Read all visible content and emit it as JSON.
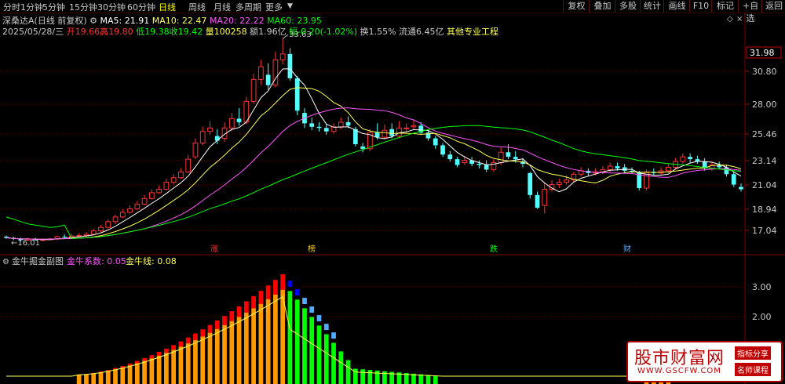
{
  "toolbar": {
    "timeframes": [
      "分时",
      "1分钟",
      "5分钟",
      "15分钟",
      "30分钟",
      "60分钟",
      "日线",
      "周线",
      "月线",
      "多周期",
      "更多"
    ],
    "active_timeframe": "日线",
    "buttons": [
      "复权",
      "叠加",
      "多股",
      "统计",
      "画线",
      "F10",
      "标记",
      "+自选",
      "返回"
    ]
  },
  "header": {
    "stock_name": "深桑达A",
    "mode": "(日线 前复权)",
    "ma5_label": "MA5: 21.91",
    "ma10_label": "MA10: 22.47",
    "ma20_label": "MA20: 22.22",
    "ma60_label": "MA60: 23.95"
  },
  "quote": {
    "date": "2025/05/28/三",
    "open": "开19.66",
    "high": "高19.80",
    "low": "低19.38",
    "close": "收19.42",
    "volume": "量100258",
    "amount": "额1.96亿",
    "change": "幅-0.20(-1.02%)",
    "turnover": "换1.55%",
    "float_value": "流通6.45亿",
    "industry": "其他专业工程"
  },
  "price_axis": [
    "30.80",
    "28.00",
    "25.46",
    "23.14",
    "21.04",
    "18.94",
    "17.04"
  ],
  "price_current": "31.98",
  "peak_label": "33.63",
  "low_label": "16.01",
  "markers": [
    "涨",
    "榜",
    "跌",
    "财"
  ],
  "sub": {
    "title": "金牛掘金副图",
    "coef_label": "金牛系数: 0.05",
    "line_label": "金牛线: 0.08",
    "axis": [
      "3.00",
      "2.00"
    ]
  },
  "watermark": {
    "title": "股市财富网",
    "url": "WWW.GSCFW.COM",
    "tag1": "指标分享",
    "tag2": "名师课程"
  },
  "colors": {
    "up": "#ff3232",
    "down": "#54ffff",
    "ma5": "#ffffff",
    "ma10": "#ffff55",
    "ma20": "#ff55ff",
    "ma60": "#00ff00",
    "orange": "#ff9900",
    "green": "#00ff00",
    "red": "#ff0000",
    "blue": "#0000ff"
  }
}
